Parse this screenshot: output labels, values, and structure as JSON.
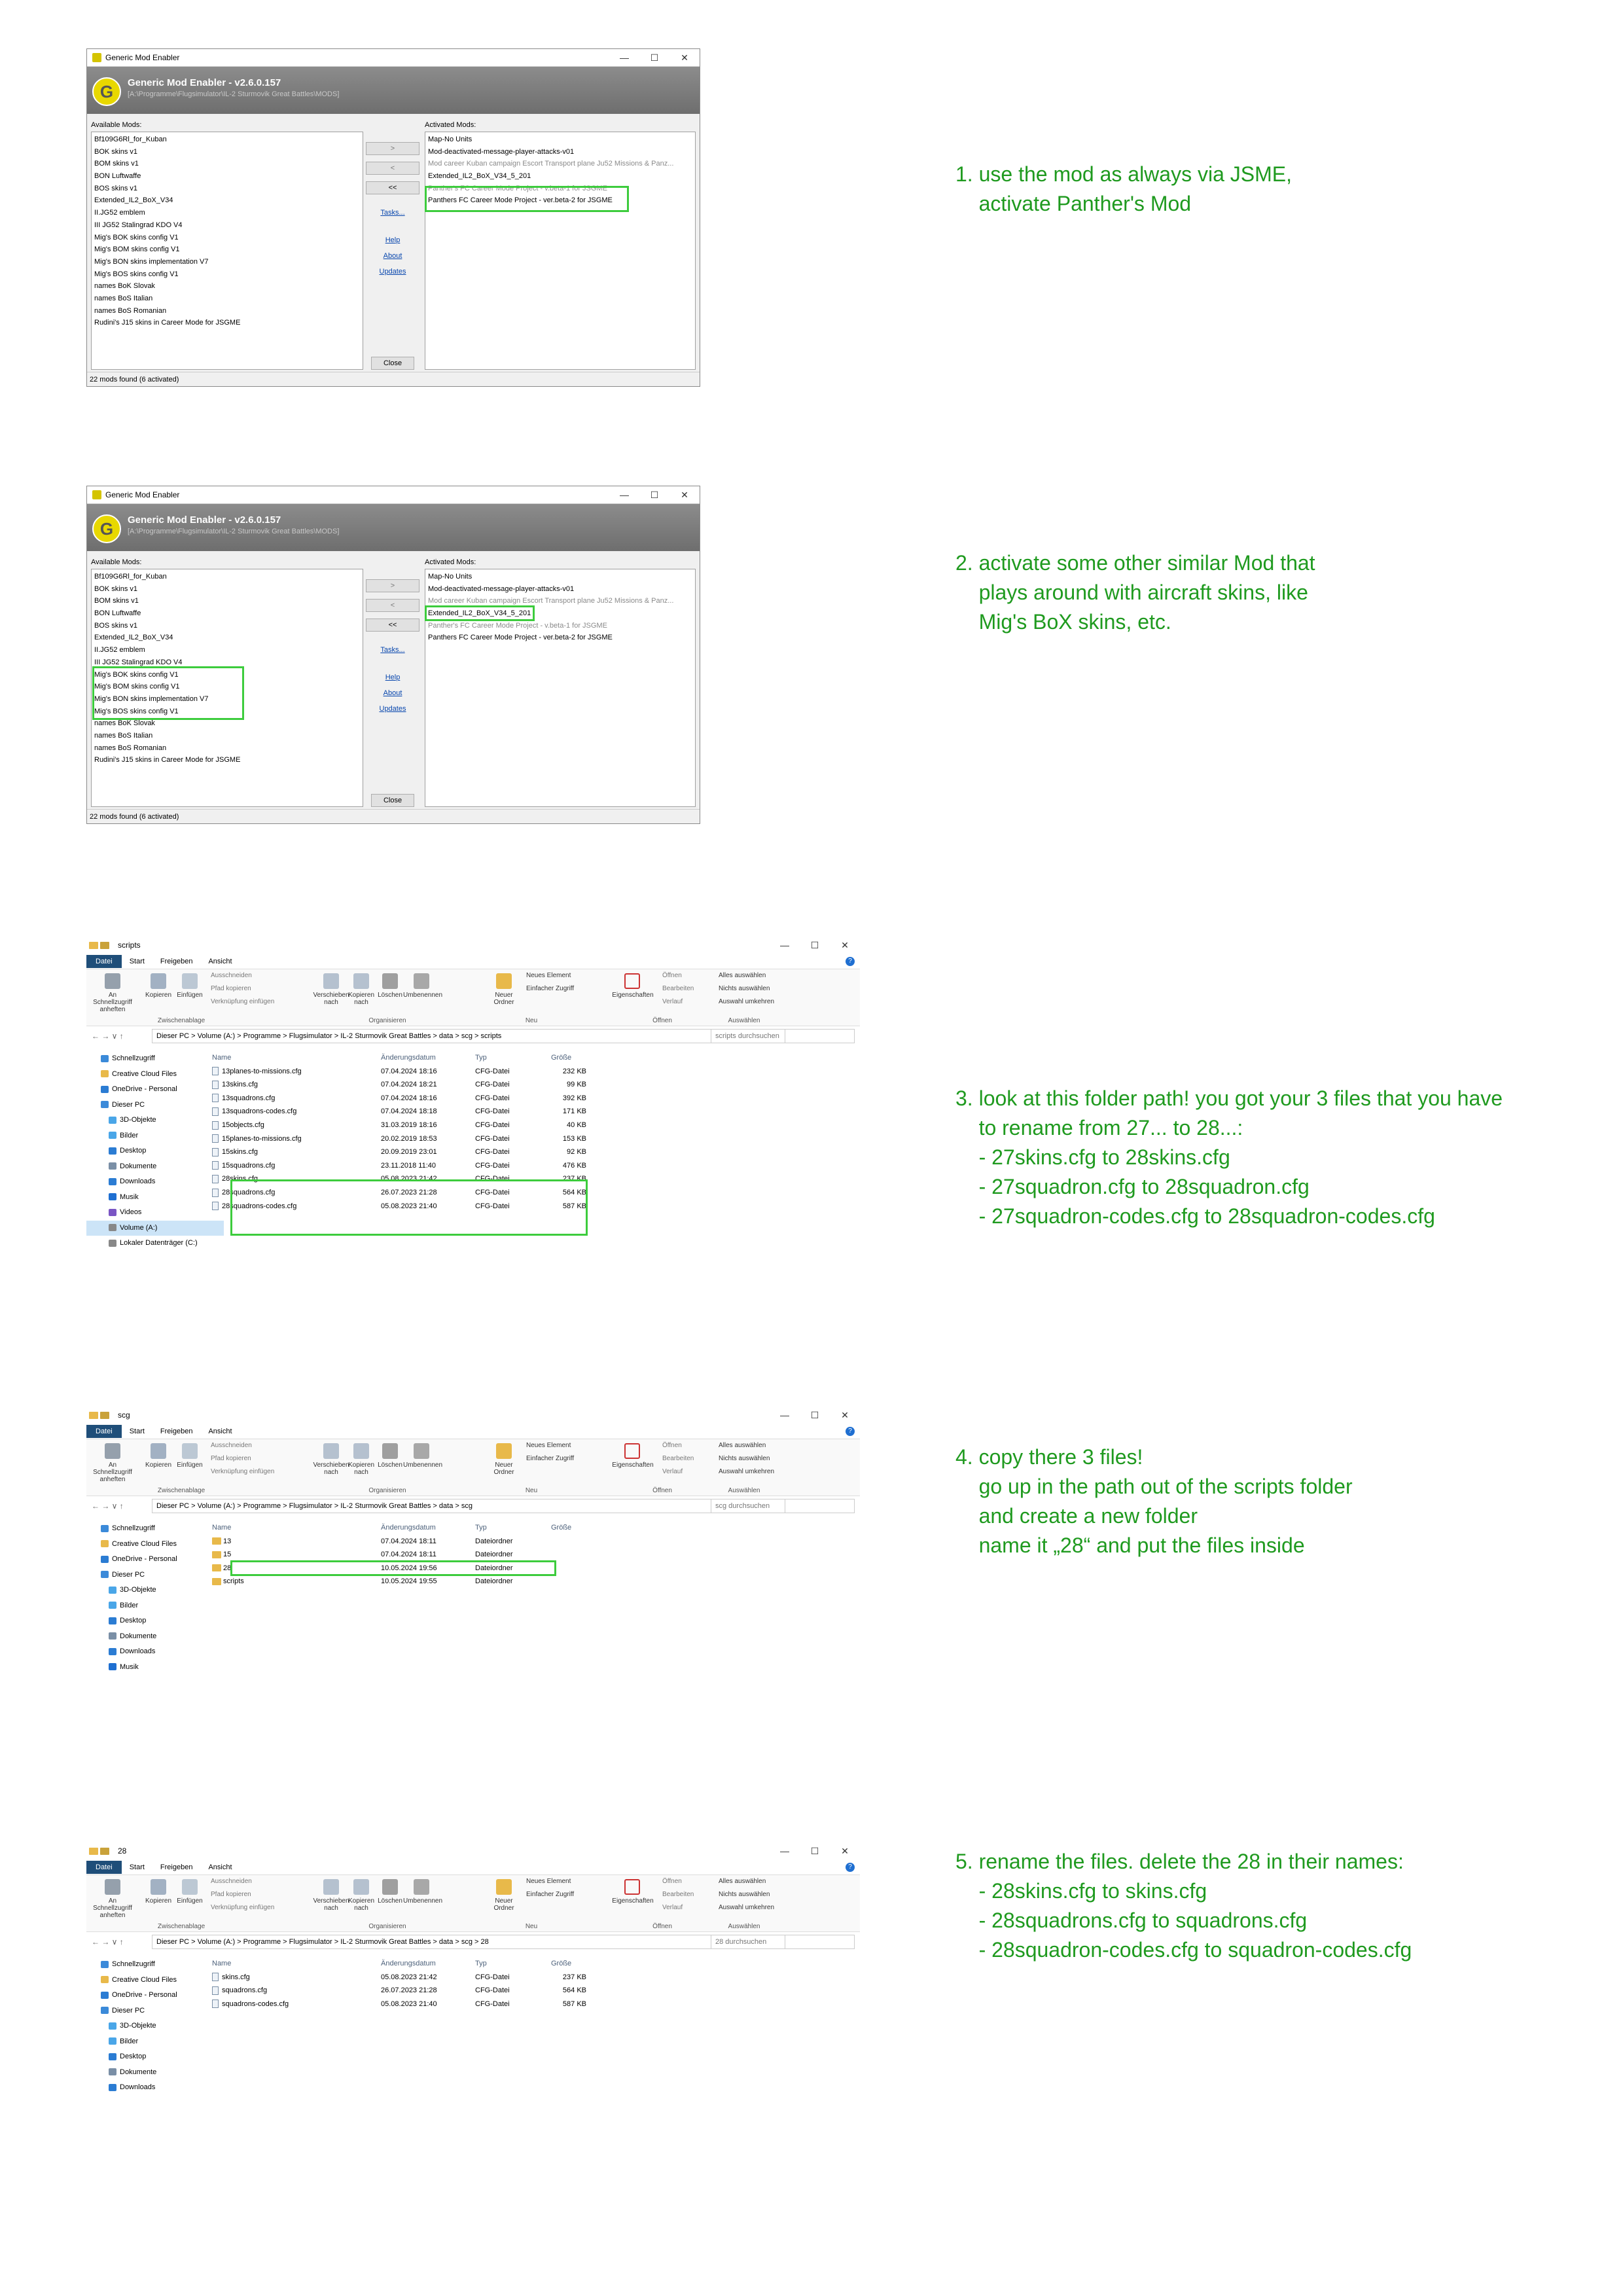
{
  "gme_windows": [
    {
      "title": "Generic Mod Enabler",
      "banner_title": "Generic Mod Enabler - v2.6.0.157",
      "banner_path": "[A:\\Programme\\Flugsimulator\\IL-2 Sturmovik Great Battles\\MODS]",
      "available_label": "Available Mods:",
      "activated_label": "Activated Mods:",
      "available": [
        "Bf109G6Rl_for_Kuban",
        "BOK skins v1",
        "BOM skins v1",
        "BON Luftwaffe",
        "BOS skins v1",
        "Extended_IL2_BoX_V34",
        "II.JG52 emblem",
        "III JG52 Stalingrad KDO V4",
        "Mig's BOK skins config V1",
        "Mig's BOM skins config V1",
        "Mig's BON skins implementation V7",
        "Mig's BOS skins config V1",
        "names BoK Slovak",
        "names BoS Italian",
        "names BoS Romanian",
        "Rudini's J15 skins in Career Mode for JSGME"
      ],
      "activated": [
        {
          "text": "Map-No Units",
          "grey": false
        },
        {
          "text": "Mod-deactivated-message-player-attacks-v01",
          "grey": false
        },
        {
          "text": "Mod career Kuban campaign Escort Transport plane Ju52 Missions & Panz...",
          "grey": true
        },
        {
          "text": "Extended_IL2_BoX_V34_5_201",
          "grey": false
        },
        {
          "text": "Panther's FC Career Mode Project - v.beta-1 for JSGME",
          "grey": true
        },
        {
          "text": "Panthers FC Career Mode Project - ver.beta-2 for JSGME",
          "grey": false
        }
      ],
      "buttons": [
        ">",
        "<",
        "<<"
      ],
      "links": [
        "Tasks...",
        "Help",
        "About",
        "Updates"
      ],
      "close": "Close",
      "status": "22 mods found (6 activated)"
    }
  ],
  "explorer": {
    "title_1": "scripts",
    "title_2": "scg",
    "title_3": "28",
    "tabs": [
      "Datei",
      "Start",
      "Freigeben",
      "Ansicht"
    ],
    "ribbon": {
      "pin": "An Schnellzugriff anheften",
      "copy": "Kopieren",
      "paste": "Einfügen",
      "cut": "Ausschneiden",
      "copypath": "Pfad kopieren",
      "shortcut": "Verknüpfung einfügen",
      "group_clip": "Zwischenablage",
      "move": "Verschieben nach",
      "copyto": "Kopieren nach",
      "delete": "Löschen",
      "rename": "Umbenennen",
      "group_org": "Organisieren",
      "newfolder": "Neuer Ordner",
      "newitem": "Neues Element",
      "easyaccess": "Einfacher Zugriff",
      "group_new": "Neu",
      "props": "Eigenschaften",
      "open": "Öffnen",
      "edit": "Bearbeiten",
      "history": "Verlauf",
      "group_open": "Öffnen",
      "selall": "Alles auswählen",
      "selnone": "Nichts auswählen",
      "selinv": "Auswahl umkehren",
      "group_sel": "Auswählen"
    },
    "path_1": "Dieser PC  >  Volume (A:)  >  Programme  >  Flugsimulator  >  IL-2 Sturmovik Great Battles  >  data  >  scg  >  scripts",
    "path_2": "Dieser PC  >  Volume (A:)  >  Programme  >  Flugsimulator  >  IL-2 Sturmovik Great Battles  >  data  >  scg",
    "path_3": "Dieser PC  >  Volume (A:)  >  Programme  >  Flugsimulator  >  IL-2 Sturmovik Great Battles  >  data  >  scg  >  28",
    "search_1": "scripts durchsuchen",
    "search_2": "scg durchsuchen",
    "search_3": "28 durchsuchen",
    "cols": [
      "Name",
      "Änderungsdatum",
      "Typ",
      "Größe"
    ],
    "nav_1": [
      "Schnellzugriff",
      "Creative Cloud Files",
      "OneDrive - Personal",
      "Dieser PC",
      "3D-Objekte",
      "Bilder",
      "Desktop",
      "Dokumente",
      "Downloads",
      "Musik",
      "Videos",
      "Volume (A:)",
      "Lokaler Datenträger (C:)"
    ],
    "nav_2": [
      "Schnellzugriff",
      "Creative Cloud Files",
      "OneDrive - Personal",
      "Dieser PC",
      "3D-Objekte",
      "Bilder",
      "Desktop",
      "Dokumente",
      "Downloads",
      "Musik"
    ],
    "nav_3": [
      "Schnellzugriff",
      "Creative Cloud Files",
      "OneDrive - Personal",
      "Dieser PC",
      "3D-Objekte",
      "Bilder",
      "Desktop",
      "Dokumente",
      "Downloads"
    ],
    "files_1": [
      [
        "13planes-to-missions.cfg",
        "07.04.2024 18:16",
        "CFG-Datei",
        "232 KB"
      ],
      [
        "13skins.cfg",
        "07.04.2024 18:21",
        "CFG-Datei",
        "99 KB"
      ],
      [
        "13squadrons.cfg",
        "07.04.2024 18:16",
        "CFG-Datei",
        "392 KB"
      ],
      [
        "13squadrons-codes.cfg",
        "07.04.2024 18:18",
        "CFG-Datei",
        "171 KB"
      ],
      [
        "15objects.cfg",
        "31.03.2019 18:16",
        "CFG-Datei",
        "40 KB"
      ],
      [
        "15planes-to-missions.cfg",
        "20.02.2019 18:53",
        "CFG-Datei",
        "153 KB"
      ],
      [
        "15skins.cfg",
        "20.09.2019 23:01",
        "CFG-Datei",
        "92 KB"
      ],
      [
        "15squadrons.cfg",
        "23.11.2018 11:40",
        "CFG-Datei",
        "476 KB"
      ],
      [
        "28skins.cfg",
        "05.08.2023 21:42",
        "CFG-Datei",
        "237 KB"
      ],
      [
        "28squadrons.cfg",
        "26.07.2023 21:28",
        "CFG-Datei",
        "564 KB"
      ],
      [
        "28squadrons-codes.cfg",
        "05.08.2023 21:40",
        "CFG-Datei",
        "587 KB"
      ]
    ],
    "files_2": [
      [
        "13",
        "07.04.2024 18:11",
        "Dateiordner",
        ""
      ],
      [
        "15",
        "07.04.2024 18:11",
        "Dateiordner",
        ""
      ],
      [
        "28",
        "10.05.2024 19:56",
        "Dateiordner",
        ""
      ],
      [
        "scripts",
        "10.05.2024 19:55",
        "Dateiordner",
        ""
      ]
    ],
    "files_3": [
      [
        "skins.cfg",
        "05.08.2023 21:42",
        "CFG-Datei",
        "237 KB"
      ],
      [
        "squadrons.cfg",
        "26.07.2023 21:28",
        "CFG-Datei",
        "564 KB"
      ],
      [
        "squadrons-codes.cfg",
        "05.08.2023 21:40",
        "CFG-Datei",
        "587 KB"
      ]
    ]
  },
  "steps": [
    "1. use the mod as always via JSME,\n    activate Panther's Mod",
    "2. activate some other similar Mod that\n    plays around with aircraft skins, like\n    Mig's BoX skins, etc.",
    "3. look at this folder path! you got your 3 files that you have\n    to rename from 27... to 28...:\n    - 27skins.cfg to 28skins.cfg\n    - 27squadron.cfg to 28squadron.cfg\n    - 27squadron-codes.cfg to 28squadron-codes.cfg",
    "4. copy there 3 files!\n    go up in the path out of the scripts folder\n    and create a new folder\n    name it „28“ and put the files inside",
    "5. rename the files. delete the 28 in their names:\n    - 28skins.cfg to skins.cfg\n    - 28squadrons.cfg to squadrons.cfg\n    - 28squadron-codes.cfg to squadron-codes.cfg"
  ],
  "colors": {
    "accent_green": "#1f9a1f",
    "highlight": "#3dcc3d",
    "datei_tab": "#1f4e79"
  }
}
